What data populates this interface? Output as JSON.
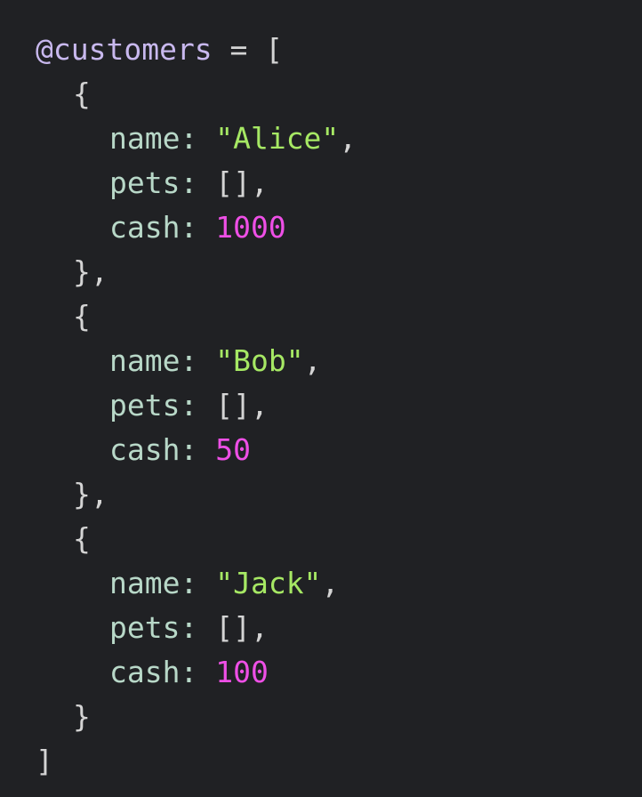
{
  "code": {
    "variable": "@customers",
    "assign": " = ",
    "open_bracket": "[",
    "close_bracket": "]",
    "open_brace": "{",
    "close_brace_comma": "},",
    "close_brace": "}",
    "customers": [
      {
        "name_key": "name:",
        "name_value": "\"Alice\"",
        "pets_key": "pets:",
        "pets_value": "[]",
        "cash_key": "cash:",
        "cash_value": "1000"
      },
      {
        "name_key": "name:",
        "name_value": "\"Bob\"",
        "pets_key": "pets:",
        "pets_value": "[]",
        "cash_key": "cash:",
        "cash_value": "50"
      },
      {
        "name_key": "name:",
        "name_value": "\"Jack\"",
        "pets_key": "pets:",
        "pets_value": "[]",
        "cash_key": "cash:",
        "cash_value": "100"
      }
    ]
  },
  "colors": {
    "background": "#202124",
    "variable": "#c8b8ee",
    "punctuation": "#d4d4d4",
    "key": "#b8d8c8",
    "string": "#a6e864",
    "number": "#ee4fe6"
  }
}
